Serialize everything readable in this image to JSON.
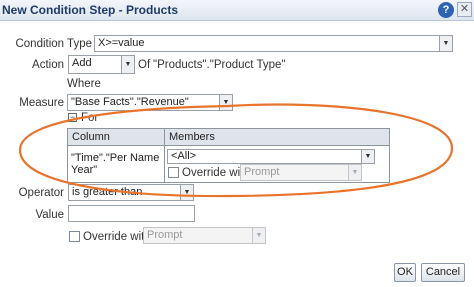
{
  "title": "New Condition Step - Products",
  "condition_type": {
    "label": "Condition Type",
    "value": "X>=value"
  },
  "action": {
    "label": "Action",
    "value": "Add",
    "of_text": "Of",
    "of_value": "\"Products\".\"Product Type\""
  },
  "where_label": "Where",
  "measure": {
    "label": "Measure",
    "value": "\"Base Facts\".\"Revenue\""
  },
  "for_section": {
    "label": "For",
    "column_header": "Column",
    "members_header": "Members",
    "row_column_value": "\"Time\".\"Per Name Year\"",
    "members_value": "<All>",
    "override_label": "Override with",
    "override_value": "Prompt"
  },
  "operator": {
    "label": "Operator",
    "value": "is greater than"
  },
  "value": {
    "label": "Value",
    "value": ""
  },
  "override": {
    "label": "Override with",
    "value": "Prompt"
  },
  "buttons": {
    "ok": "OK",
    "cancel": "Cancel"
  },
  "icons": {
    "help": "?",
    "close": "✕",
    "dropdown": "▼"
  },
  "colors": {
    "annotation": "#e8742c",
    "title_text": "#1f3a66",
    "help_blue": "#2d63b3"
  }
}
